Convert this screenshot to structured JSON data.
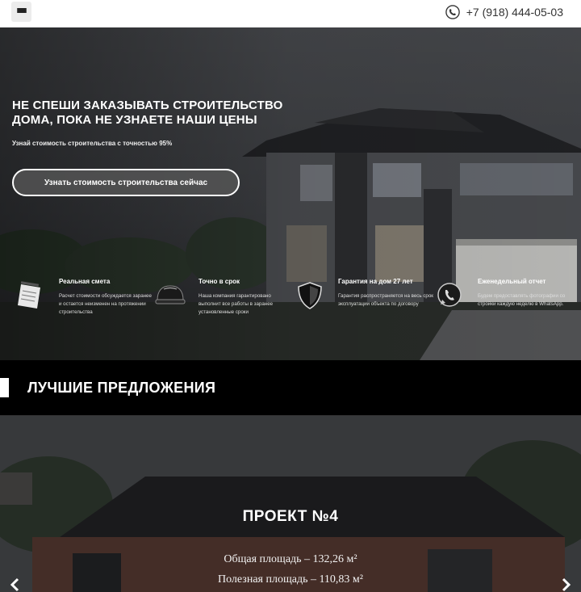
{
  "header": {
    "menu_icon": "hamburger-menu-icon",
    "phone_icon": "phone-icon",
    "phone": "+7 (918) 444-05-03"
  },
  "hero": {
    "title": "НЕ СПЕШИ ЗАКАЗЫВАТЬ СТРОИТЕЛЬСТВО ДОМА, ПОКА НЕ УЗНАЕТЕ НАШИ ЦЕНЫ",
    "subtitle": "Узнай стоимость строительства с точностью 95%",
    "cta_label": "Узнать стоимость строительства сейчас"
  },
  "features": [
    {
      "icon": "notepad-icon",
      "title": "Реальная смета",
      "text": "Расчет стоимости обсуждается заранее и остается неизменен на протяжении строительства"
    },
    {
      "icon": "helmet-icon",
      "title": "Точно в срок",
      "text": "Наша компания гарантировано выполнит все работы в заранее установленные сроки"
    },
    {
      "icon": "shield-icon",
      "title": "Гарантия на дом 27 лет",
      "text": "Гарантия распространяется на весь срок эксплуатации объекта по договору"
    },
    {
      "icon": "whatsapp-icon",
      "title": "Еженедельный отчет",
      "text": "Будем предоставлять фотографии со стройки каждую неделю в WhatsApp."
    }
  ],
  "offers": {
    "title": "ЛУЧШИЕ ПРЕДЛОЖЕНИЯ"
  },
  "project": {
    "title": "ПРОЕКТ №4",
    "total_area": "Общая площадь – 132,26 м²",
    "usable_area": "Полезная площадь – 110,83 м²",
    "prev_icon": "chevron-left-icon",
    "next_icon": "chevron-right-icon"
  }
}
